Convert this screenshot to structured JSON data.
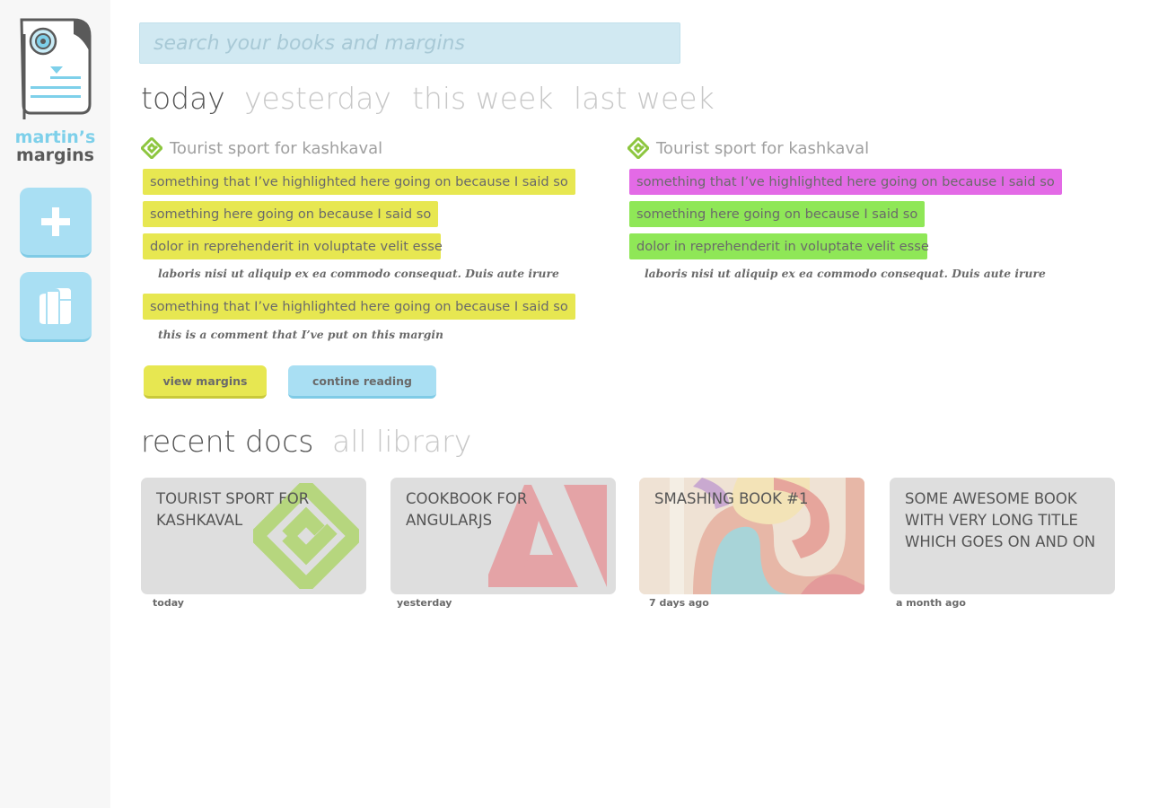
{
  "brand": {
    "line1": "martin’s",
    "line2": "margins"
  },
  "sidebar": {
    "add_icon": "plus-icon",
    "library_icon": "books-icon"
  },
  "search": {
    "placeholder": "search your books and margins",
    "value": ""
  },
  "period_tabs": [
    {
      "label": "today",
      "active": true
    },
    {
      "label": "yesterday",
      "active": false
    },
    {
      "label": "this week",
      "active": false
    },
    {
      "label": "last week",
      "active": false
    }
  ],
  "margins": [
    {
      "book": "Tourist sport for kashkaval",
      "book_icon": "epub-icon",
      "highlights": [
        {
          "text": "something that I’ve highlighted here going on because I said so",
          "color": "#e7e751"
        },
        {
          "text": "something here going on because I said so",
          "color": "#e7e751"
        },
        {
          "text": "dolor in reprehenderit in voluptate velit esse",
          "color": "#e7e751",
          "comment": "laboris nisi ut aliquip ex ea commodo consequat. Duis aute irure"
        },
        {
          "text": "something that I’ve highlighted here going on because I said so",
          "color": "#e7e751",
          "comment": "this is a comment that I’ve put on this margin"
        }
      ]
    },
    {
      "book": "Tourist sport for kashkaval",
      "book_icon": "epub-icon",
      "highlights": [
        {
          "text": "something that I’ve highlighted here going on because I said so",
          "color": "#e36ae6"
        },
        {
          "text": "something here going on because I said so",
          "color": "#8fe757"
        },
        {
          "text": "dolor in reprehenderit in voluptate velit esse",
          "color": "#8fe757",
          "comment": "laboris nisi ut aliquip ex ea commodo consequat. Duis aute irure"
        }
      ]
    }
  ],
  "actions": {
    "view_margins": "view margins",
    "continue_reading": "contine reading"
  },
  "doc_tabs": [
    {
      "label": "recent docs",
      "active": true
    },
    {
      "label": "all library",
      "active": false
    }
  ],
  "docs": [
    {
      "title": "Tourist sport for kashkaval",
      "date": "today",
      "cover": "epub-logo-icon"
    },
    {
      "title": "Cookbook for AngularJS",
      "date": "yesterday",
      "cover": "adobe-pdf-logo-icon"
    },
    {
      "title": "Smashing book #1",
      "date": "7 days ago",
      "cover": "smashing-book-cover-image"
    },
    {
      "title": "Some awesome book with very long title which goes on and on",
      "date": "a month ago",
      "cover": "none"
    }
  ],
  "colors": {
    "accent_blue": "#a9dff3",
    "highlight_yellow": "#e7e751",
    "highlight_green": "#8fe757",
    "highlight_magenta": "#e36ae6",
    "brand_blue": "#7ed0ea"
  }
}
